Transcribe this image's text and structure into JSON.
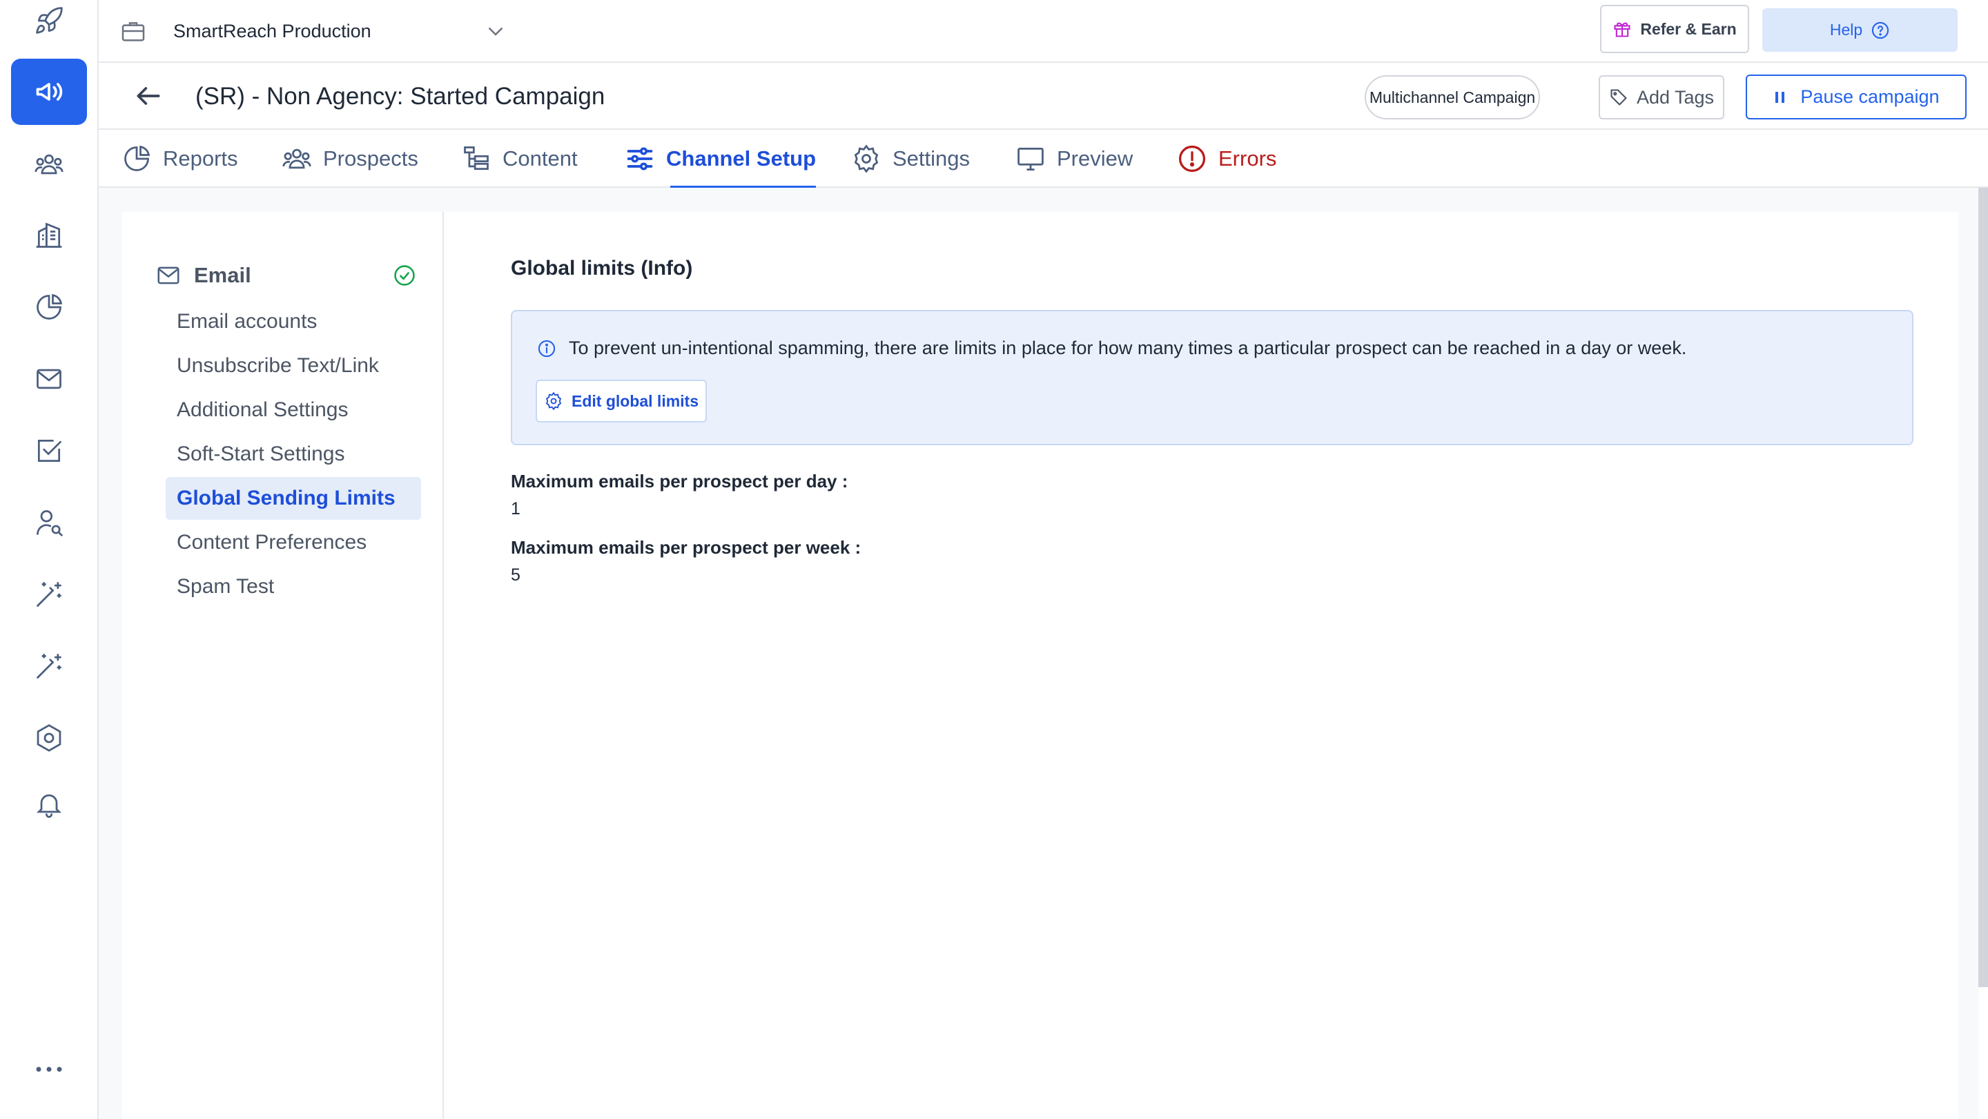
{
  "workspace": {
    "name": "SmartReach Production"
  },
  "topbar": {
    "refer_label": "Refer & Earn",
    "help_label": "Help"
  },
  "campaign": {
    "title": "(SR) - Non Agency: Started Campaign",
    "type_label": "Multichannel Campaign",
    "add_tags_label": "Add Tags",
    "pause_label": "Pause campaign"
  },
  "tabs": [
    {
      "label": "Reports",
      "icon": "pie-chart-icon"
    },
    {
      "label": "Prospects",
      "icon": "users-icon"
    },
    {
      "label": "Content",
      "icon": "tree-icon"
    },
    {
      "label": "Channel Setup",
      "icon": "sliders-icon",
      "active": true
    },
    {
      "label": "Settings",
      "icon": "gear-icon"
    },
    {
      "label": "Preview",
      "icon": "monitor-icon"
    },
    {
      "label": "Errors",
      "icon": "error-icon"
    }
  ],
  "sidebar_rail": [
    "rocket-icon",
    "megaphone-icon",
    "team-icon",
    "building-icon",
    "pie-chart-icon",
    "mail-icon",
    "task-check-icon",
    "user-search-icon",
    "magic-wand-icon",
    "magic-wand-icon",
    "hexagon-settings-icon",
    "bell-icon",
    "more-icon"
  ],
  "subnav": {
    "heading": "Email",
    "items": [
      {
        "label": "Email accounts"
      },
      {
        "label": "Unsubscribe Text/Link"
      },
      {
        "label": "Additional Settings"
      },
      {
        "label": "Soft-Start Settings"
      },
      {
        "label": "Global Sending Limits",
        "active": true
      },
      {
        "label": "Content Preferences"
      },
      {
        "label": "Spam Test"
      }
    ]
  },
  "panel": {
    "title": "Global limits (Info)",
    "info_text": "To prevent un-intentional spamming, there are limits in place for how many times a particular prospect can be reached in a day or week.",
    "edit_button": "Edit global limits",
    "limits": [
      {
        "label": "Maximum emails per prospect per day :",
        "value": "1"
      },
      {
        "label": "Maximum emails per prospect per week :",
        "value": "5"
      }
    ]
  },
  "colors": {
    "accent": "#2563eb",
    "error": "#b91c1c",
    "success": "#16a34a",
    "info_bg": "#eaf1fd"
  }
}
